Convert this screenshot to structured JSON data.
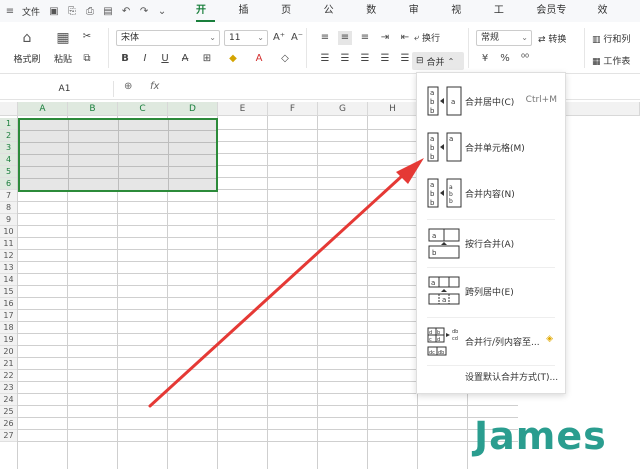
{
  "menubar": {
    "file_label": "文件",
    "tabs": [
      "开始",
      "插入",
      "页面",
      "公式",
      "数据",
      "审阅",
      "视图",
      "工具",
      "会员专享",
      "效率"
    ],
    "active_tab": "开始"
  },
  "ribbon": {
    "format_painter": "格式刷",
    "paste": "粘贴",
    "font_name": "宋体",
    "font_size": "11",
    "wrap_text": "换行",
    "merge": "合并",
    "number_format": "常规",
    "convert": "转换",
    "row_col": "行和列",
    "worksheet": "工作表"
  },
  "formula_bar": {
    "name_box": "A1",
    "fx_label": "fx"
  },
  "grid": {
    "columns": [
      "A",
      "B",
      "C",
      "D",
      "E",
      "F",
      "G",
      "H"
    ],
    "rows": [
      "1",
      "2",
      "3",
      "4",
      "5",
      "6",
      "7",
      "8",
      "9",
      "10",
      "11",
      "12",
      "13",
      "14",
      "15",
      "16",
      "17",
      "18",
      "19",
      "20",
      "21",
      "22",
      "23",
      "24",
      "25",
      "26",
      "27"
    ]
  },
  "merge_menu": {
    "items": [
      {
        "label": "合并居中(C)",
        "shortcut": "Ctrl+M"
      },
      {
        "label": "合并单元格(M)",
        "shortcut": ""
      },
      {
        "label": "合并内容(N)",
        "shortcut": ""
      },
      {
        "label": "按行合并(A)",
        "shortcut": ""
      },
      {
        "label": "跨列居中(E)",
        "shortcut": ""
      },
      {
        "label": "合并行/列内容至...",
        "shortcut": ""
      }
    ],
    "footer": "设置默认合并方式(T)..."
  },
  "watermark": "James",
  "colors": {
    "accent": "#1a7f3c",
    "selection_border": "#2c8b3a",
    "arrow": "#e53935",
    "watermark": "#2a9d8f"
  }
}
